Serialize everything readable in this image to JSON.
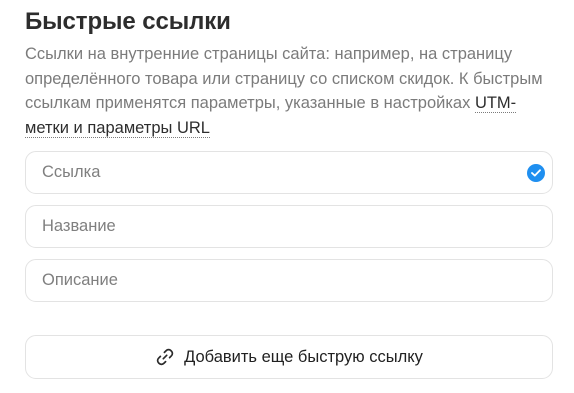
{
  "section": {
    "title": "Быстрые ссылки",
    "description_text": "Ссылки на внутренние страницы сайта: например, на страницу определённого товара или страницу со списком скидок. К быстрым ссылкам применятся параметры, указанные в настройках ",
    "description_link": "UTM-метки и параметры URL"
  },
  "fields": {
    "link": {
      "placeholder": "Ссылка",
      "value": "",
      "status_icon": "check-circle-icon"
    },
    "name": {
      "placeholder": "Название",
      "value": ""
    },
    "description": {
      "placeholder": "Описание",
      "value": ""
    }
  },
  "add_button": {
    "label": "Добавить еще быструю ссылку",
    "icon": "link-icon"
  },
  "colors": {
    "accent": "#1f8ff0",
    "title": "#2d2d2d",
    "muted_text": "#7b7b7b",
    "border": "#e3e3e3"
  }
}
